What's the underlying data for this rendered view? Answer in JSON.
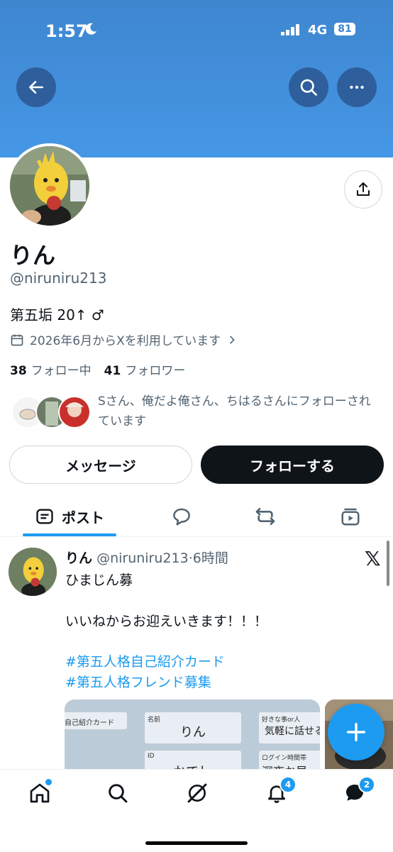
{
  "status_bar": {
    "time": "1:57",
    "network": "4G",
    "battery": "81"
  },
  "profile": {
    "name": "りん",
    "handle": "@niruniru213",
    "bio": "第五垢 20↑ ♂",
    "joined": "2026年6月からXを利用しています",
    "following_count": "38",
    "following_label": "フォロー中",
    "followers_count": "41",
    "followers_label": "フォロワー",
    "followed_by": "Sさん、俺だよ俺さん、ちはるさんにフォローされています"
  },
  "actions": {
    "message_label": "メッセージ",
    "follow_label": "フォローする"
  },
  "tabs": [
    {
      "label": "ポスト",
      "active": true
    }
  ],
  "post": {
    "author": "りん",
    "handle": "@niruniru213",
    "time": "·6時間",
    "lines": [
      "ひまじん募",
      "いいねからお迎えいきます！！！"
    ],
    "hashtags": [
      "#第五人格自己紹介カード",
      "#第五人格フレンド募集"
    ],
    "card": {
      "header": "自己紹介カード",
      "name_label": "名前",
      "name_value": "りん",
      "likes_label": "好きな事or人",
      "likes_value": "気軽に話せる",
      "id_label": "ID",
      "id_value": "かでし",
      "login_label": "ログイン時間帯",
      "login_value": "深夜お昼"
    }
  },
  "nav": {
    "notifications_badge": "4",
    "messages_badge": "2"
  },
  "colors": {
    "accent": "#1d9bf0",
    "banner": "#4597e6",
    "text": "#0f1419",
    "muted": "#536471"
  }
}
